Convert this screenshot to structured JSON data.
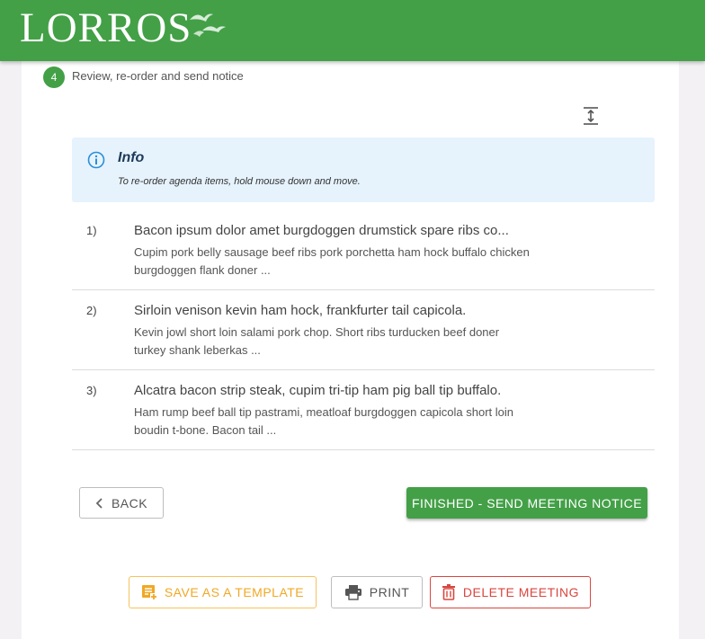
{
  "header": {
    "logo_text": "LORROS",
    "brand_color": "#43a047"
  },
  "step": {
    "number": "4",
    "label": "Review, re-order and send notice"
  },
  "toolbar": {
    "expand_icon": "expand-vertical-icon"
  },
  "info": {
    "icon": "info-icon",
    "title": "Info",
    "text": "To re-order agenda items, hold mouse down and move.",
    "background": "#e6f3fd"
  },
  "agenda": {
    "items": [
      {
        "number": "1)",
        "title": "Bacon ipsum dolor amet burgdoggen drumstick spare ribs co...",
        "desc": "Cupim pork belly sausage beef ribs pork porchetta ham hock buffalo chicken burgdoggen flank doner ..."
      },
      {
        "number": "2)",
        "title": "Sirloin venison kevin ham hock, frankfurter tail capicola.",
        "desc": "Kevin jowl short loin salami pork chop. Short ribs turducken beef doner turkey shank leberkas ..."
      },
      {
        "number": "3)",
        "title": "Alcatra bacon strip steak, cupim tri-tip ham pig ball tip buffalo.",
        "desc": "Ham rump beef ball tip pastrami, meatloaf burgdoggen capicola short loin boudin t-bone. Bacon tail ..."
      }
    ]
  },
  "actions": {
    "back": "BACK",
    "finish": "FINISHED - SEND MEETING NOTICE",
    "template": "SAVE AS A TEMPLATE",
    "print": "PRINT",
    "delete": "DELETE MEETING"
  },
  "colors": {
    "warning": "#f0a825",
    "danger": "#d9463f"
  }
}
